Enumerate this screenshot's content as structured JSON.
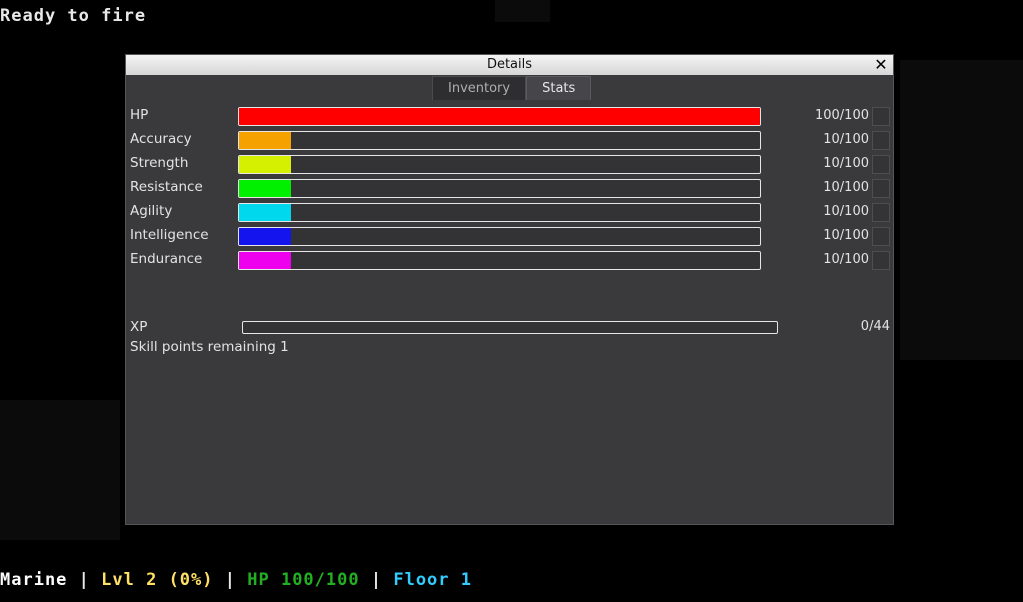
{
  "message_log": {
    "previous": "",
    "current": "Ready to fire"
  },
  "dialog": {
    "title": "Details",
    "close_glyph": "✕",
    "tabs": [
      {
        "label": "Inventory",
        "active": false
      },
      {
        "label": "Stats",
        "active": true
      }
    ],
    "stats": [
      {
        "name": "HP",
        "value": "100/100",
        "fraction": 1.0,
        "color": "#ff0000"
      },
      {
        "name": "Accuracy",
        "value": "10/100",
        "fraction": 0.1,
        "color": "#f5a200"
      },
      {
        "name": "Strength",
        "value": "10/100",
        "fraction": 0.1,
        "color": "#d5f000"
      },
      {
        "name": "Resistance",
        "value": "10/100",
        "fraction": 0.1,
        "color": "#00f000"
      },
      {
        "name": "Agility",
        "value": "10/100",
        "fraction": 0.1,
        "color": "#00d8ee"
      },
      {
        "name": "Intelligence",
        "value": "10/100",
        "fraction": 0.1,
        "color": "#1414ee"
      },
      {
        "name": "Endurance",
        "value": "10/100",
        "fraction": 0.1,
        "color": "#ee00ee"
      }
    ],
    "xp": {
      "label": "XP",
      "value": "0/44",
      "fraction": 0.0
    },
    "skill_points": "Skill points remaining 1"
  },
  "status_bar": {
    "class_name": "Marine",
    "level": "Lvl 2 (0%)",
    "hp": "HP 100/100",
    "floor": "Floor 1",
    "separator": "|",
    "colors": {
      "class": "#ffffff",
      "level": "#ffe066",
      "hp": "#22b022",
      "floor": "#33ccff"
    }
  }
}
